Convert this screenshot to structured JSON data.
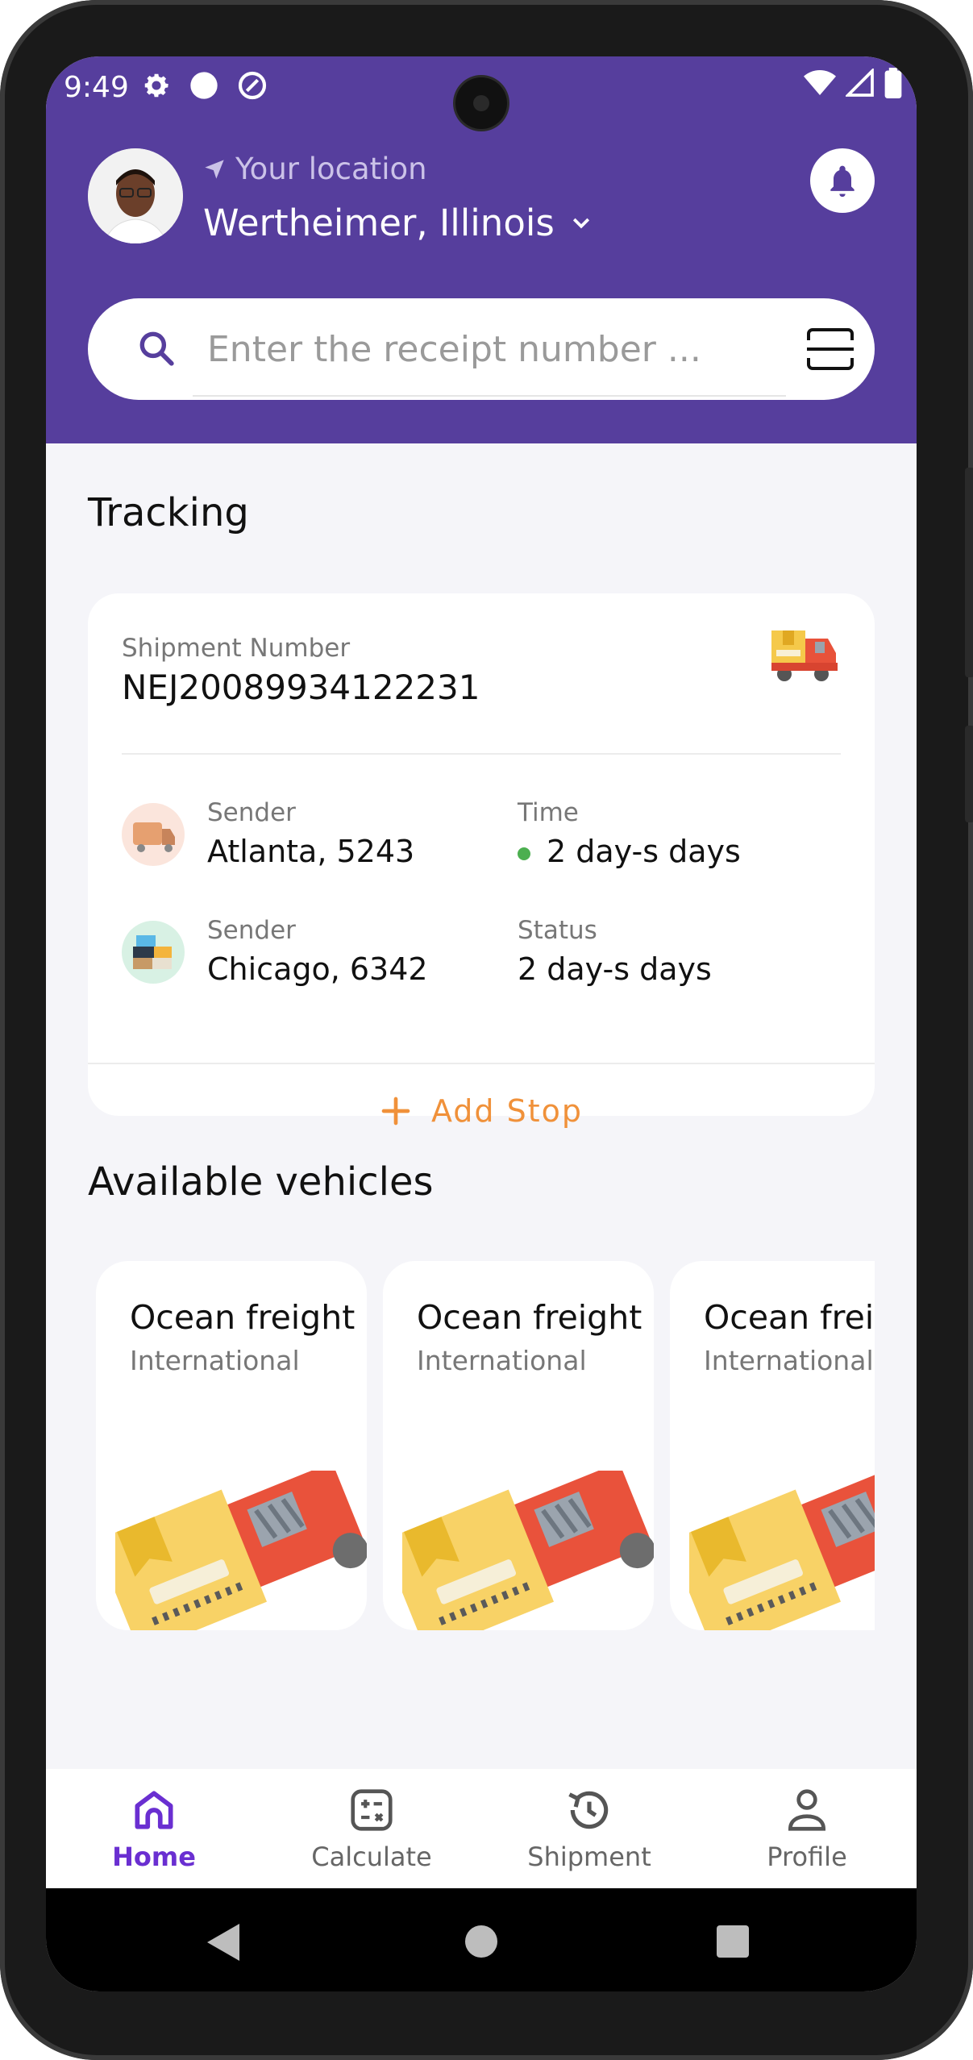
{
  "status_bar": {
    "time": "9:49"
  },
  "header": {
    "location_label": "Your location",
    "location_value": "Wertheimer, Illinois"
  },
  "search": {
    "placeholder": "Enter the receipt number ..."
  },
  "tracking": {
    "title": "Tracking",
    "shipment_label": "Shipment Number",
    "shipment_number": "NEJ20089934122231",
    "rows": [
      {
        "label": "Sender",
        "value": "Atlanta, 5243",
        "side_label": "Time",
        "side_value": "2 day-s days"
      },
      {
        "label": "Sender",
        "value": "Chicago, 6342",
        "side_label": "Status",
        "side_value": "2 day-s days"
      }
    ],
    "add_stop": "Add Stop"
  },
  "vehicles": {
    "title": "Available vehicles",
    "items": [
      {
        "title": "Ocean freight",
        "subtitle": "International"
      },
      {
        "title": "Ocean freight",
        "subtitle": "International"
      },
      {
        "title": "Ocean freight",
        "subtitle": "International"
      }
    ]
  },
  "bottom_nav": [
    {
      "label": "Home",
      "icon": "home-icon",
      "active": true
    },
    {
      "label": "Calculate",
      "icon": "calculator-icon"
    },
    {
      "label": "Shipment",
      "icon": "history-icon"
    },
    {
      "label": "Profile",
      "icon": "person-icon"
    }
  ],
  "colors": {
    "header": "#563e9d",
    "accent": "#f0913a",
    "active_nav": "#6a2fd1",
    "status_dot": "#4caf50"
  }
}
